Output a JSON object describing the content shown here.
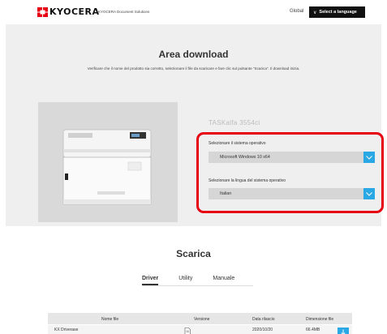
{
  "header": {
    "logo_text": "KYOCERA",
    "logo_sub": "KYOCERA Document Solutions",
    "global_label": "Global",
    "language_button": "Select a language"
  },
  "download": {
    "title": "Area download",
    "description": "Verificare che il nome del prodotto sia corretto, selezionare il file da scaricare e fare clic sul pulsante \"Scarica\". Il download inizia.",
    "model_name": "TASKalfa 3554ci",
    "os_label": "Selezionare il sistema operativo",
    "os_value": "Microsoft Windows 10 x64",
    "lang_label": "Selezionare la lingua del sistema operativo",
    "lang_value": "Italian"
  },
  "scarica": {
    "title": "Scarica",
    "tabs": [
      {
        "label": "Driver",
        "active": true
      },
      {
        "label": "Utility",
        "active": false
      },
      {
        "label": "Manuale",
        "active": false
      }
    ]
  },
  "table": {
    "headers": {
      "name": "Nome file",
      "version": "Versione",
      "date": "Data rilascio",
      "size": "Dimensione file"
    },
    "rows": [
      {
        "name": "KX Driverase",
        "version": "",
        "date": "2020/10/20",
        "size": "66.4MB"
      }
    ]
  },
  "colors": {
    "accent": "#2aa8e6",
    "highlight": "#e60012",
    "section_bg": "#efefef"
  }
}
